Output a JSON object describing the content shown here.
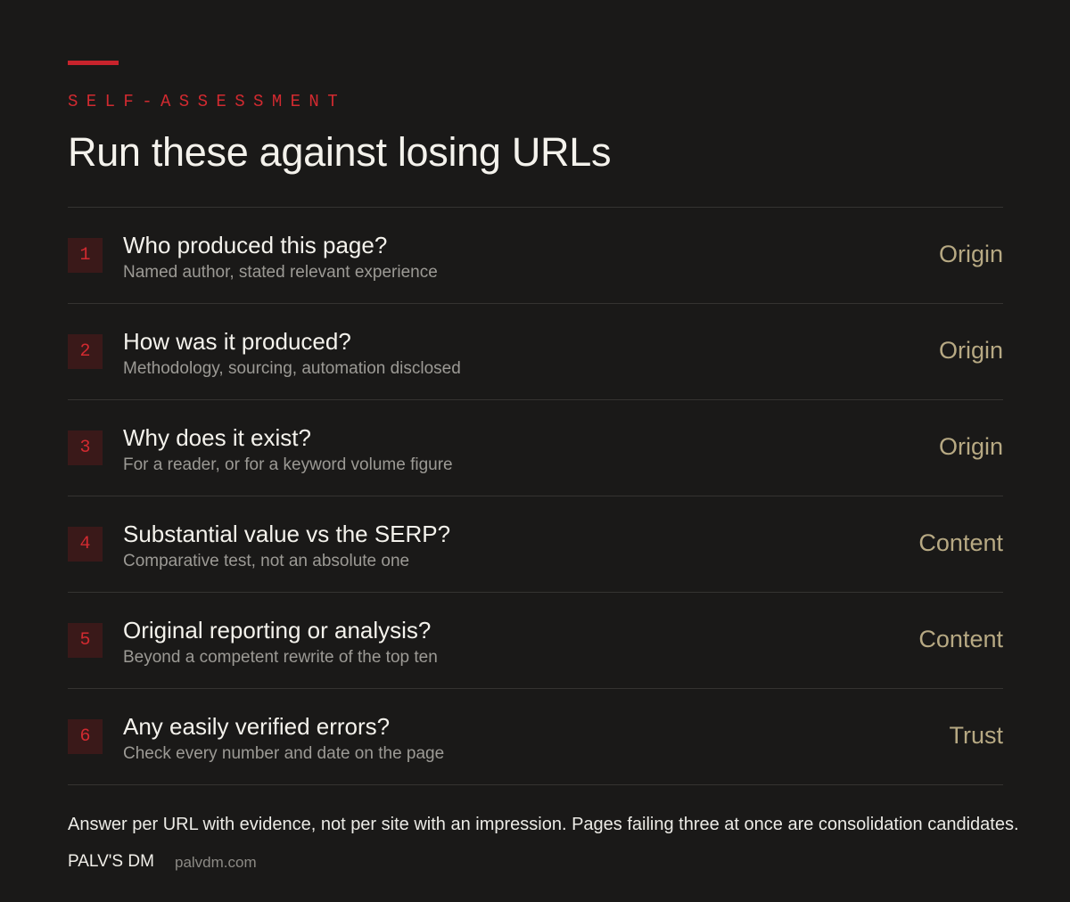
{
  "header": {
    "eyebrow": "SELF-ASSESSMENT",
    "title": "Run these against losing URLs"
  },
  "items": [
    {
      "number": "1",
      "question": "Who produced this page?",
      "detail": "Named author, stated relevant experience",
      "category": "Origin"
    },
    {
      "number": "2",
      "question": "How was it produced?",
      "detail": "Methodology, sourcing, automation disclosed",
      "category": "Origin"
    },
    {
      "number": "3",
      "question": "Why does it exist?",
      "detail": "For a reader, or for a keyword volume figure",
      "category": "Origin"
    },
    {
      "number": "4",
      "question": "Substantial value vs the SERP?",
      "detail": "Comparative test, not an absolute one",
      "category": "Content"
    },
    {
      "number": "5",
      "question": "Original reporting or analysis?",
      "detail": "Beyond a competent rewrite of the top ten",
      "category": "Content"
    },
    {
      "number": "6",
      "question": "Any easily verified errors?",
      "detail": "Check every number and date on the page",
      "category": "Trust"
    }
  ],
  "footer": {
    "note": "Answer per URL with evidence, not per site with an impression. Pages failing three at once are consolidation candidates.",
    "brand": "PALV'S DM",
    "domain": "palvdm.com"
  },
  "colors": {
    "background": "#1a1918",
    "accent": "#c8232c",
    "category": "#b7a983"
  }
}
